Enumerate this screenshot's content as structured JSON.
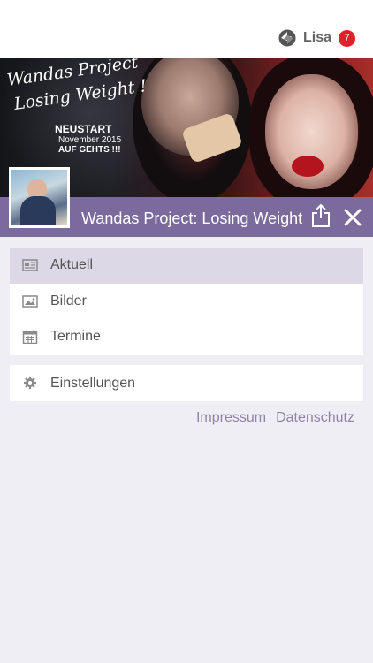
{
  "header": {
    "user_name": "Lisa",
    "notification_count": "7"
  },
  "banner": {
    "line1": "Wandas Project",
    "line2": "Losing Weight !",
    "line3": "NEUSTART",
    "line4": "November 2015",
    "line5": "AUF GEHTS !!!"
  },
  "titlebar": {
    "title": "Wandas Project: Losing Weight"
  },
  "menu": {
    "items": [
      {
        "label": "Aktuell",
        "icon": "newspaper-icon",
        "active": true
      },
      {
        "label": "Bilder",
        "icon": "image-icon",
        "active": false
      },
      {
        "label": "Termine",
        "icon": "calendar-icon",
        "active": false
      }
    ],
    "settings_label": "Einstellungen",
    "settings_icon": "gear-icon"
  },
  "footer": {
    "impressum": "Impressum",
    "datenschutz": "Datenschutz"
  },
  "colors": {
    "accent": "#7b6a9c",
    "active_item": "#dcd8e6",
    "link": "#8f83a8",
    "badge": "#e0212c",
    "background": "#efeef4"
  }
}
